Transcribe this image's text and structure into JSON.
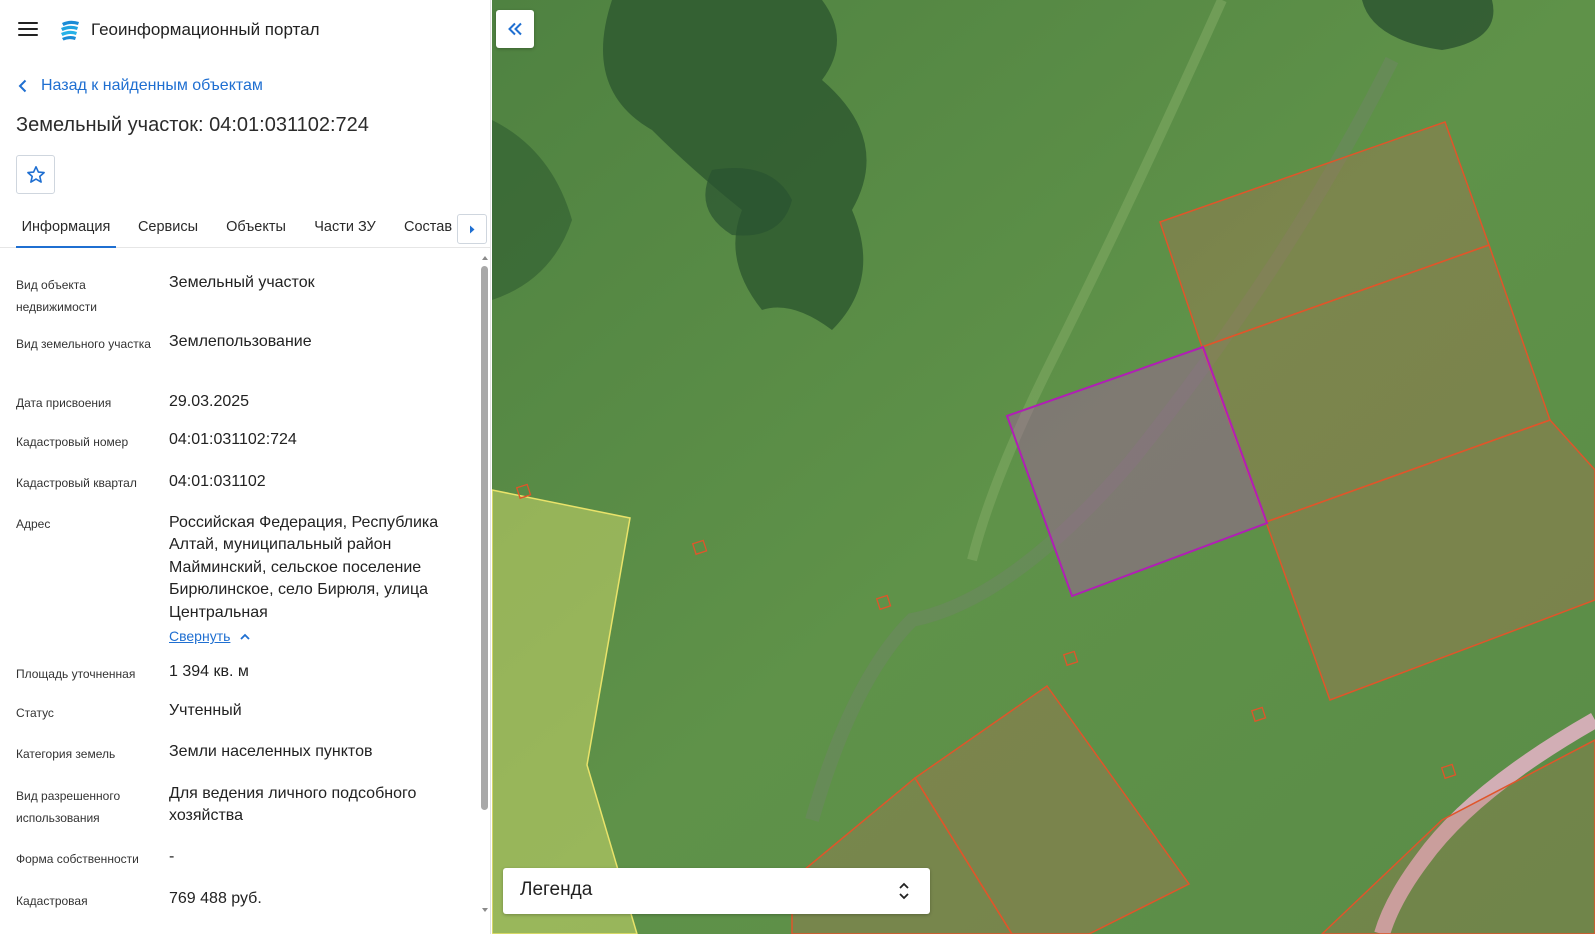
{
  "header": {
    "app_title": "Геоинформационный портал",
    "menu_icon": "hamburger-menu-icon",
    "logo_icon": "portal-logo-icon"
  },
  "nav": {
    "back_label": "Назад к найденным объектам"
  },
  "object": {
    "title": "Земельный участок: 04:01:031102:724"
  },
  "tabs": [
    {
      "label": "Информация",
      "active": true
    },
    {
      "label": "Сервисы",
      "active": false
    },
    {
      "label": "Объекты",
      "active": false
    },
    {
      "label": "Части ЗУ",
      "active": false
    },
    {
      "label": "Состав",
      "active": false
    }
  ],
  "info": [
    {
      "label": "Вид объекта недвижимости",
      "value": "Земельный участок"
    },
    {
      "label": "Вид земельного участка",
      "value": "Землепользование"
    },
    {
      "label": "Дата присвоения",
      "value": "29.03.2025"
    },
    {
      "label": "Кадастровый номер",
      "value": "04:01:031102:724"
    },
    {
      "label": "Кадастровый квартал",
      "value": "04:01:031102"
    },
    {
      "label": "Адрес",
      "value": "Российская Федерация, Республика Алтай, муниципальный район Майминский, сельское поселение Бирюлинское, село Бирюля, улица Центральная",
      "link": "Свернуть"
    },
    {
      "label": "Площадь уточненная",
      "value": "1 394 кв. м"
    },
    {
      "label": "Статус",
      "value": "Учтенный"
    },
    {
      "label": "Категория земель",
      "value": "Земли населенных пунктов"
    },
    {
      "label": "Вид разрешенного использования",
      "value": "Для ведения личного подсобного хозяйства"
    },
    {
      "label": "Форма собственности",
      "value": "-"
    },
    {
      "label": "Кадастровая",
      "value": "769 488 руб."
    }
  ],
  "map": {
    "legend_label": "Легенда",
    "colors": {
      "selected_parcel": "#b01fb5",
      "parcel_border": "#e0552a",
      "zone_border": "#e9e36a",
      "accent": "#1f6fd1"
    }
  }
}
